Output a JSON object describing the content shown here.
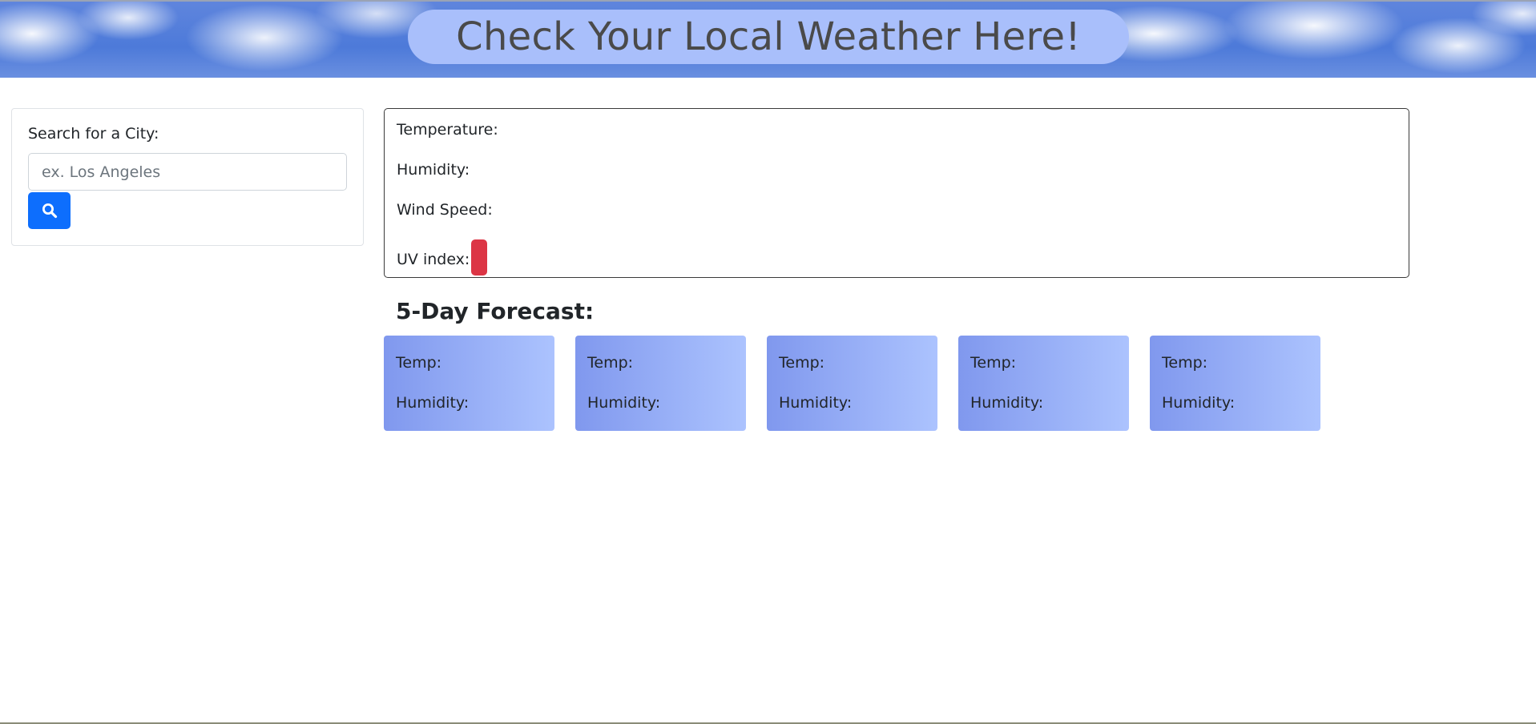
{
  "header": {
    "title": "Check Your Local Weather Here!"
  },
  "search": {
    "label": "Search for a City:",
    "placeholder": "ex. Los Angeles",
    "value": "",
    "button_icon": "search-icon"
  },
  "current": {
    "temperature_label": "Temperature:",
    "humidity_label": "Humidity:",
    "wind_label": "Wind Speed:",
    "uv_label": "UV index:",
    "uv_badge_color": "#dc3545"
  },
  "forecast": {
    "title": "5-Day Forecast:",
    "days": [
      {
        "temp_label": "Temp:",
        "humidity_label": "Humidity:"
      },
      {
        "temp_label": "Temp:",
        "humidity_label": "Humidity:"
      },
      {
        "temp_label": "Temp:",
        "humidity_label": "Humidity:"
      },
      {
        "temp_label": "Temp:",
        "humidity_label": "Humidity:"
      },
      {
        "temp_label": "Temp:",
        "humidity_label": "Humidity:"
      }
    ]
  },
  "colors": {
    "accent": "#0d6efd",
    "banner_pill": "#a9bffb",
    "forecast_gradient_start": "#8098ee",
    "forecast_gradient_end": "#acc3fe"
  }
}
